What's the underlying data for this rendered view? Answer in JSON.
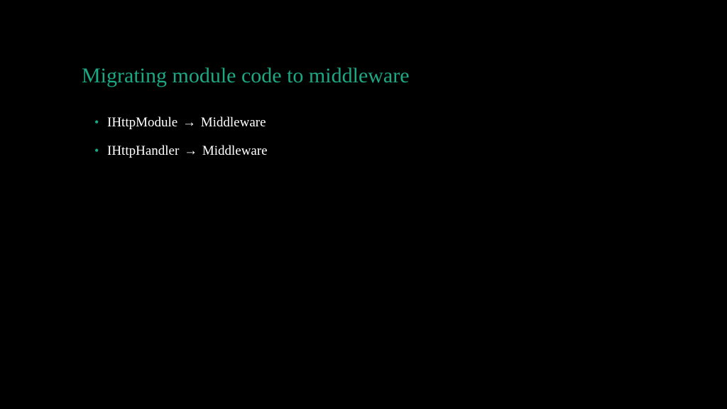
{
  "slide": {
    "title": "Migrating module code to middleware",
    "bullets": [
      {
        "before": "IHttpModule",
        "arrow": "→",
        "after": "Middleware"
      },
      {
        "before": "IHttpHandler",
        "arrow": "→",
        "after": "Middleware"
      }
    ]
  }
}
